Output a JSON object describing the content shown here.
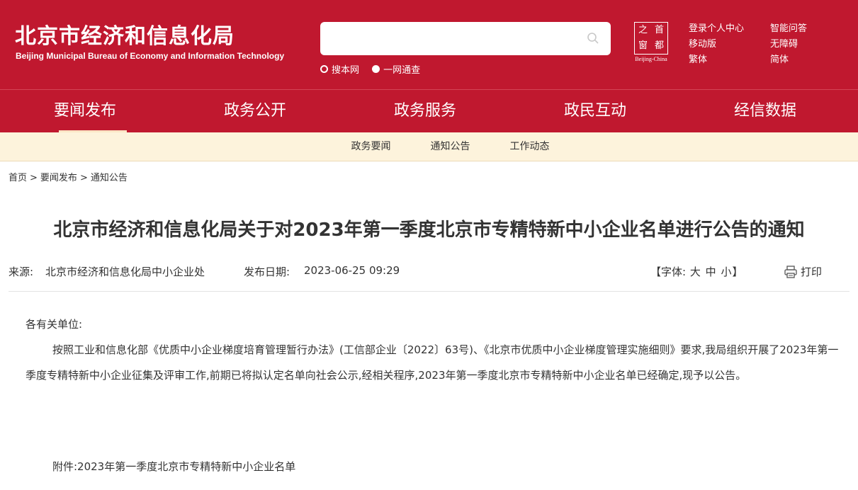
{
  "header": {
    "logo_cn": "北京市经济和信息化局",
    "logo_en": "Beijing Municipal Bureau of Economy and Information Technology",
    "search": {
      "placeholder": "",
      "value": ""
    },
    "search_options": [
      "搜本网",
      "一网通查"
    ],
    "badge": {
      "chars": [
        "之",
        "首",
        "窗",
        "都"
      ],
      "en": "Beijing-China"
    },
    "links_col1": [
      "登录个人中心",
      "移动版",
      "繁体"
    ],
    "links_col2": [
      "智能问答",
      "无障碍",
      "简体"
    ]
  },
  "nav": [
    "要闻发布",
    "政务公开",
    "政务服务",
    "政民互动",
    "经信数据"
  ],
  "subnav": [
    "政务要闻",
    "通知公告",
    "工作动态"
  ],
  "breadcrumb": [
    "首页",
    "要闻发布",
    "通知公告"
  ],
  "article": {
    "title": "北京市经济和信息化局关于对2023年第一季度北京市专精特新中小企业名单进行公告的通知",
    "source_label": "来源:",
    "source": "北京市经济和信息化局中小企业处",
    "date_label": "发布日期:",
    "date": "2023-06-25 09:29",
    "font_label": "【字体:",
    "font_sizes": [
      "大",
      "中",
      "小"
    ],
    "font_end": "】",
    "print": "打印",
    "salutation": "各有关单位:",
    "body": "按照工业和信息化部《优质中小企业梯度培育管理暂行办法》(工信部企业〔2022〕63号)、《北京市优质中小企业梯度管理实施细则》要求,我局组织开展了2023年第一季度专精特新中小企业征集及评审工作,前期已将拟认定名单向社会公示,经相关程序,2023年第一季度北京市专精特新中小企业名单已经确定,现予以公告。",
    "attachment": "附件:2023年第一季度北京市专精特新中小企业名单"
  },
  "colors": {
    "brand_red": "#c0182f",
    "subnav_bg": "#fdf3dc",
    "active_underline": "#fbe6c6"
  }
}
